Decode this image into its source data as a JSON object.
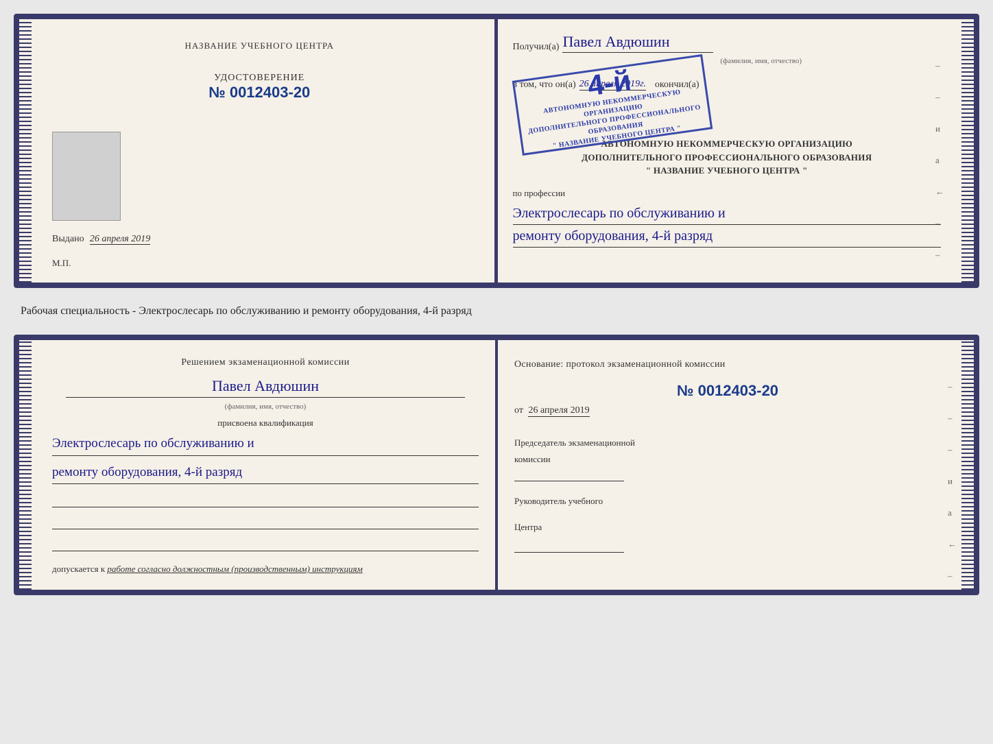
{
  "topDoc": {
    "leftPage": {
      "centerTitle": "НАЗВАНИЕ УЧЕБНОГО ЦЕНТРА",
      "certLabel": "УДОСТОВЕРЕНИЕ",
      "certNumber": "№ 0012403-20",
      "issuedLabel": "Выдано",
      "issuedDate": "26 апреля 2019",
      "mpLabel": "М.П."
    },
    "rightPage": {
      "receivedLabel": "Получил(а)",
      "recipientName": "Павел Авдюшин",
      "recipientSubtext": "(фамилия, имя, отчество)",
      "inThatLabel": "в том, что он(а)",
      "completedDate": "26 апреля 2019г.",
      "completedLabel": "окончил(а)",
      "stampNumber": "4-й",
      "orgLine1": "АВТОНОМНУЮ НЕКОММЕРЧЕСКУЮ ОРГАНИЗАЦИЮ",
      "orgLine2": "ДОПОЛНИТЕЛЬНОГО ПРОФЕССИОНАЛЬНОГО ОБРАЗОВАНИЯ",
      "orgLine3": "\" НАЗВАНИЕ УЧЕБНОГО ЦЕНТРА \"",
      "professionLabel": "по профессии",
      "professionLine1": "Электрослесарь по обслуживанию и",
      "professionLine2": "ремонту оборудования, 4-й разряд"
    }
  },
  "middleText": "Рабочая специальность - Электрослесарь по обслуживанию и ремонту оборудования, 4-й разряд",
  "bottomDoc": {
    "leftPage": {
      "decisionTitle": "Решением экзаменационной комиссии",
      "personName": "Павел Авдюшин",
      "personSubtext": "(фамилия, имя, отчество)",
      "assignedLabel": "присвоена квалификация",
      "qualLine1": "Электрослесарь по обслуживанию и",
      "qualLine2": "ремонту оборудования, 4-й разряд",
      "admissionLabel": "допускается к",
      "admissionText": "работе согласно должностным (производственным) инструкциям"
    },
    "rightPage": {
      "basisLabel": "Основание: протокол экзаменационной комиссии",
      "protocolNumber": "№ 0012403-20",
      "fromLabel": "от",
      "fromDate": "26 апреля 2019",
      "chairmanLabel1": "Председатель экзаменационной",
      "chairmanLabel2": "комиссии",
      "directorLabel1": "Руководитель учебного",
      "directorLabel2": "Центра"
    }
  },
  "decoChars": {
    "dash": "–",
    "italic_a": "а",
    "left_arrow": "←"
  }
}
